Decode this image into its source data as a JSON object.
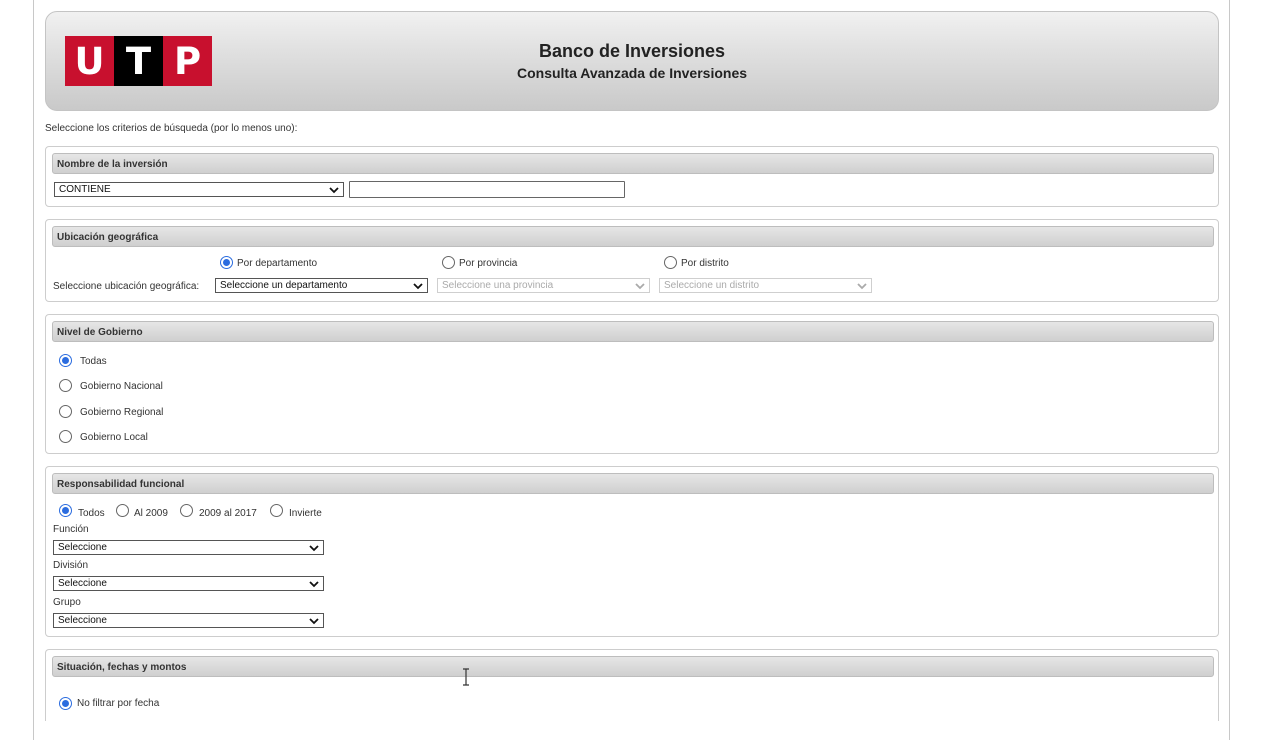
{
  "header": {
    "logo": [
      "U",
      "T",
      "P"
    ],
    "title": "Banco de Inversiones",
    "subtitle": "Consulta Avanzada de Inversiones",
    "brand_color": "#c8102e"
  },
  "intro": "Seleccione los criterios de búsqueda (por lo menos uno):",
  "nombre": {
    "heading": "Nombre de la inversión",
    "operator_value": "CONTIENE",
    "text_value": ""
  },
  "ubicacion": {
    "heading": "Ubicación geográfica",
    "options": [
      "Por departamento",
      "Por provincia",
      "Por distrito"
    ],
    "selected": "Por departamento",
    "label": "Seleccione ubicación geográfica:",
    "departamento": "Seleccione un departamento",
    "provincia": "Seleccione una provincia",
    "distrito": "Seleccione un distrito"
  },
  "nivel": {
    "heading": "Nivel de Gobierno",
    "options": [
      "Todas",
      "Gobierno Nacional",
      "Gobierno Regional",
      "Gobierno Local"
    ],
    "selected": "Todas"
  },
  "responsabilidad": {
    "heading": "Responsabilidad funcional",
    "options": [
      "Todos",
      "Al 2009",
      "2009 al 2017",
      "Invierte"
    ],
    "selected": "Todos",
    "funcion_label": "Función",
    "funcion_value": "Seleccione",
    "division_label": "División",
    "division_value": "Seleccione",
    "grupo_label": "Grupo",
    "grupo_value": "Seleccione"
  },
  "situacion": {
    "heading": "Situación, fechas y montos",
    "fecha_option": "No filtrar por fecha"
  },
  "colors": {
    "radio_selected": "#2b6cdf",
    "section_border": "#cdcdcd"
  }
}
